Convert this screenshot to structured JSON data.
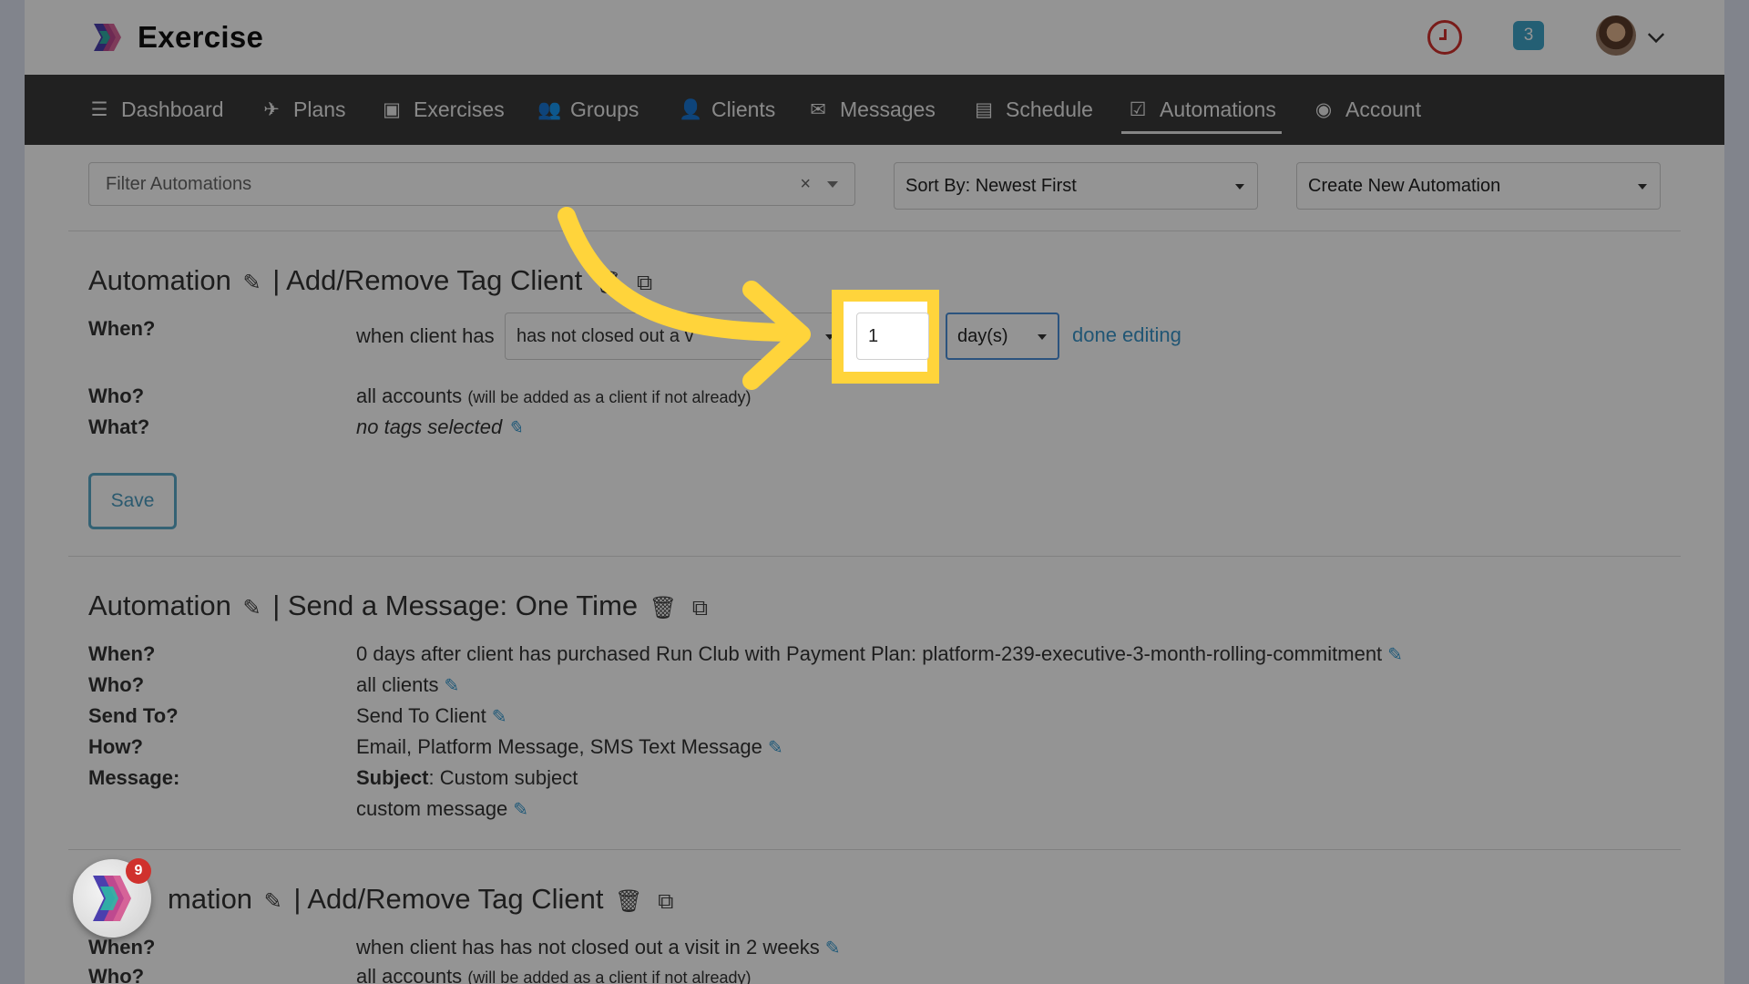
{
  "app": {
    "name": "Exercise"
  },
  "header": {
    "notification_count": "3"
  },
  "nav": [
    {
      "label": "Dashboard",
      "icon": "list-icon"
    },
    {
      "label": "Plans",
      "icon": "bird-icon"
    },
    {
      "label": "Exercises",
      "icon": "square-icon"
    },
    {
      "label": "Groups",
      "icon": "group-icon"
    },
    {
      "label": "Clients",
      "icon": "user-icon"
    },
    {
      "label": "Messages",
      "icon": "envelope-icon"
    },
    {
      "label": "Schedule",
      "icon": "book-icon"
    },
    {
      "label": "Automations",
      "icon": "check-square-icon",
      "active": true
    },
    {
      "label": "Account",
      "icon": "user-circle-icon"
    }
  ],
  "filter": {
    "placeholder": "Filter Automations",
    "clear": "×"
  },
  "sort": {
    "value": "Sort By: Newest First"
  },
  "create": {
    "value": "Create New Automation"
  },
  "automations": [
    {
      "title_prefix": "Automation",
      "title_sep": "|",
      "title": "Add/Remove Tag Client",
      "when_label": "When?",
      "when_prefix": "when client has",
      "condition": "has not closed out a v",
      "amount": "1",
      "unit": "day(s)",
      "done": "done editing",
      "who_label": "Who?",
      "who": "all accounts",
      "who_note": "(will be added as a client if not already)",
      "what_label": "What?",
      "what": "no tags selected",
      "save": "Save"
    },
    {
      "title_prefix": "Automation",
      "title_sep": "|",
      "title": "Send a Message: One Time",
      "when_label": "When?",
      "when": "0 days after client has purchased Run Club with Payment Plan: platform-239-executive-3-month-rolling-commitment",
      "who_label": "Who?",
      "who": "all clients",
      "sendto_label": "Send To?",
      "sendto": "Send To Client",
      "how_label": "How?",
      "how": "Email, Platform Message, SMS Text Message",
      "message_label": "Message:",
      "subject_label": "Subject",
      "subject": ": Custom subject",
      "message": "custom message"
    },
    {
      "title_prefix": "mation",
      "title_sep": "|",
      "title": "Add/Remove Tag Client",
      "when_label": "When?",
      "when": "when client has has not closed out a visit in 2 weeks",
      "who_label": "Who?",
      "who": "all accounts",
      "who_note": "(will be added as a client if not already)"
    }
  ],
  "launcher": {
    "badge": "9"
  },
  "colors": {
    "highlight": "#ffd43b",
    "nav_bg": "#3a3a3a",
    "link": "#3a94c9",
    "accent": "#5aa9c9"
  }
}
